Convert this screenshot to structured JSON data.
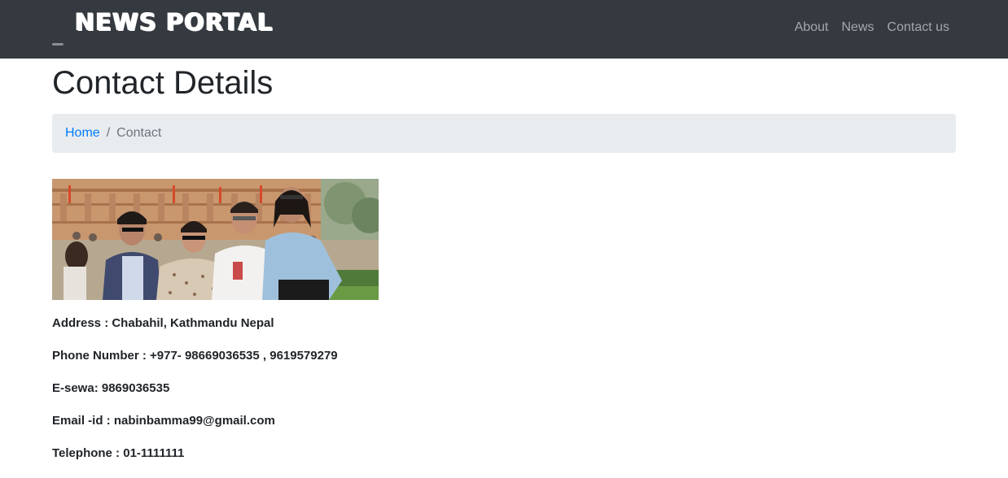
{
  "navbar": {
    "brand": "NEWS PORTAL",
    "links": [
      {
        "label": "About"
      },
      {
        "label": "News"
      },
      {
        "label": "Contact us"
      }
    ]
  },
  "page": {
    "title": "Contact Details"
  },
  "breadcrumb": {
    "home": "Home",
    "separator": "/",
    "current": "Contact"
  },
  "photo": {
    "icon": "group-photo-image"
  },
  "contact": {
    "address": "Address :  Chabahil, Kathmandu Nepal",
    "phone": "Phone Number : +977- 98669036535 , 9619579279",
    "esewa": "E-sewa: 9869036535",
    "email": "Email -id : nabinbamma99@gmail.com",
    "telephone": "Telephone : 01-1111111"
  },
  "colors": {
    "navbar_bg": "#343a40",
    "link_blue": "#007bff",
    "breadcrumb_bg": "#e9ecef"
  }
}
